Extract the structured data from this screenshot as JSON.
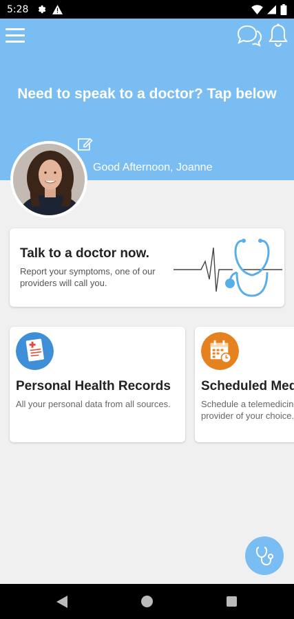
{
  "status_bar": {
    "time": "5:28"
  },
  "header": {
    "headline": "Need to speak to a doctor? Tap below",
    "greeting": "Good Afternoon, Joanne",
    "icons": [
      "menu-icon",
      "chat-icon",
      "bell-icon",
      "edit-icon"
    ]
  },
  "talk_card": {
    "title": "Talk to a doctor now.",
    "subtitle": "Report your symptoms, one of our providers will call you."
  },
  "features": [
    {
      "title": "Personal Health Records",
      "description": "All your personal data from all sources.",
      "icon": "medical-record-icon",
      "icon_color": "#3e8fd8"
    },
    {
      "title": "Scheduled Medical Visits",
      "description": "Schedule a telemedicine visit with a provider of your choice.",
      "icon": "calendar-icon",
      "icon_color": "#e5821f"
    }
  ],
  "colors": {
    "primary": "#79bdf2",
    "background": "#f0f0f0",
    "card": "#ffffff"
  }
}
